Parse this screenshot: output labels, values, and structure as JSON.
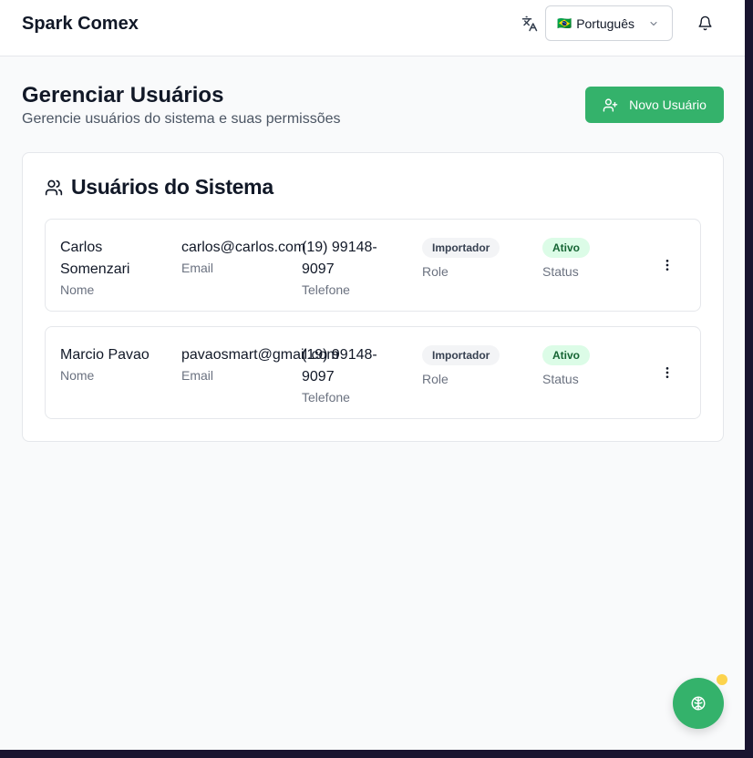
{
  "app": {
    "brand": "Spark Comex"
  },
  "header": {
    "language": {
      "flag": "🇧🇷",
      "label": "Português"
    }
  },
  "page": {
    "title": "Gerenciar Usuários",
    "subtitle": "Gerencie usuários do sistema e suas permissões",
    "new_user_label": "Novo Usuário"
  },
  "card": {
    "title": "Usuários do Sistema"
  },
  "labels": {
    "name": "Nome",
    "email": "Email",
    "phone": "Telefone",
    "role": "Role",
    "status": "Status"
  },
  "users": [
    {
      "name": "Carlos Somenzari",
      "email": "carlos@carlos.com",
      "phone": "(19) 99148-9097",
      "role": "Importador",
      "status": "Ativo"
    },
    {
      "name": "Marcio Pavao",
      "email": "pavaosmart@gmail.com",
      "phone": "(19) 99148-9097",
      "role": "Importador",
      "status": "Ativo"
    }
  ],
  "colors": {
    "accent": "#34b26b",
    "status_bg": "#dcfce7",
    "status_text": "#166534",
    "notification_dot": "#fcd34d"
  },
  "icons": {
    "translate": "translate-icon",
    "chevron": "chevron-down-icon",
    "bell": "bell-icon",
    "add_user": "user-plus-icon",
    "users": "users-icon",
    "more": "more-vertical-icon",
    "fab": "brain-icon"
  }
}
